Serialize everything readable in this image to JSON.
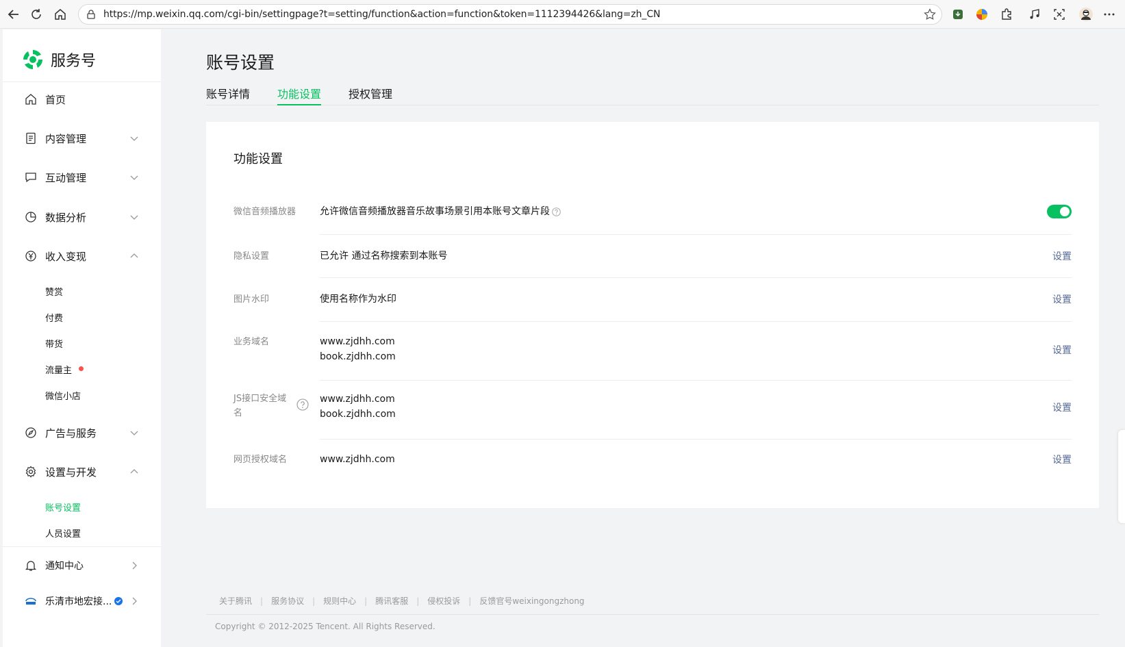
{
  "browser": {
    "url": "https://mp.weixin.qq.com/cgi-bin/settingpage?t=setting/function&action=function&token=1112394426&lang=zh_CN"
  },
  "brand": {
    "name": "服务号",
    "accent": "#07c160"
  },
  "sidebar": {
    "items": [
      {
        "label": "首页",
        "icon": "home-icon"
      },
      {
        "label": "内容管理",
        "icon": "document-icon",
        "expanded": false
      },
      {
        "label": "互动管理",
        "icon": "chat-icon",
        "expanded": false
      },
      {
        "label": "数据分析",
        "icon": "pie-chart-icon",
        "expanded": false
      },
      {
        "label": "收入变现",
        "icon": "yuan-icon",
        "expanded": true
      },
      {
        "label": "广告与服务",
        "icon": "compass-icon",
        "expanded": false
      },
      {
        "label": "设置与开发",
        "icon": "gear-icon",
        "expanded": true
      }
    ],
    "income_sub": [
      "赞赏",
      "付费",
      "带货",
      "流量主",
      "微信小店"
    ],
    "settings_sub": [
      "账号设置",
      "人员设置"
    ],
    "active_sub": "账号设置",
    "notification": "通知中心",
    "account_name": "乐清市地宏接..."
  },
  "page": {
    "title": "账号设置",
    "tabs": [
      {
        "label": "账号详情",
        "active": false
      },
      {
        "label": "功能设置",
        "active": true
      },
      {
        "label": "授权管理",
        "active": false
      }
    ]
  },
  "card": {
    "title": "功能设置",
    "rows": [
      {
        "label": "微信音频播放器",
        "value": "允许微信音频播放器音乐故事场景引用本账号文章片段",
        "control": "toggle",
        "enabled": true
      },
      {
        "label": "隐私设置",
        "value": "已允许 通过名称搜索到本账号",
        "link": "设置"
      },
      {
        "label": "图片水印",
        "value": "使用名称作为水印",
        "link": "设置"
      },
      {
        "label": "业务域名",
        "values": [
          "www.zjdhh.com",
          "book.zjdhh.com"
        ],
        "link": "设置"
      },
      {
        "label": "JS接口安全域名",
        "values": [
          "www.zjdhh.com",
          "book.zjdhh.com"
        ],
        "link": "设置"
      },
      {
        "label": "网页授权域名",
        "value": "www.zjdhh.com",
        "link": "设置"
      }
    ]
  },
  "footer": {
    "links": [
      "关于腾讯",
      "服务协议",
      "规则中心",
      "腾讯客服",
      "侵权投诉",
      "反馈官号weixingongzhong"
    ],
    "copyright": "Copyright © 2012-2025 Tencent. All Rights Reserved."
  }
}
